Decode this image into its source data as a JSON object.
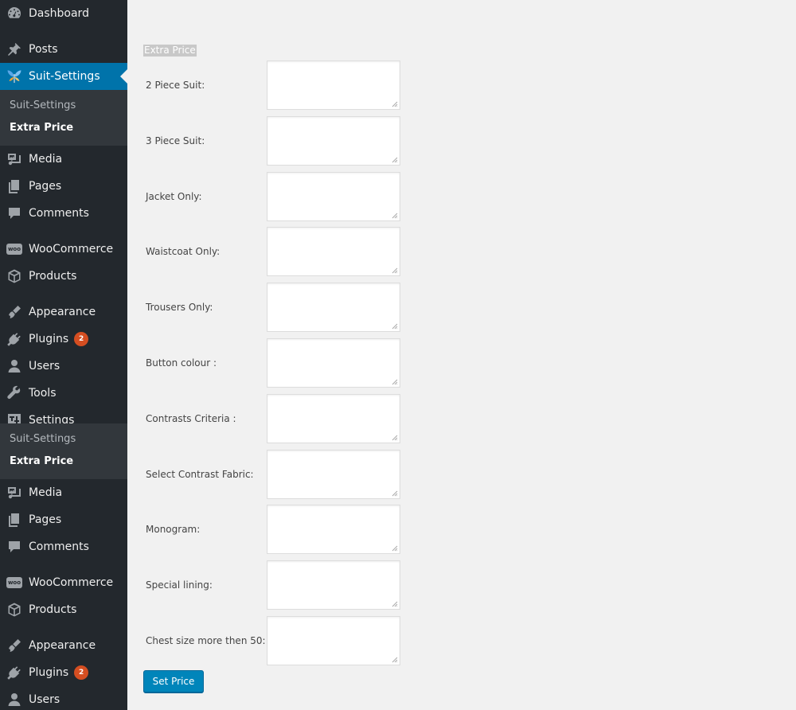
{
  "sidebar": {
    "items": [
      {
        "id": "dashboard",
        "label": "Dashboard",
        "icon": "dashboard-icon"
      },
      {
        "id": "posts",
        "label": "Posts",
        "icon": "pin-icon"
      },
      {
        "id": "suit-settings",
        "label": "Suit-Settings",
        "icon": "butterfly-icon",
        "active": true
      },
      {
        "id": "media",
        "label": "Media",
        "icon": "media-icon"
      },
      {
        "id": "pages",
        "label": "Pages",
        "icon": "pages-icon"
      },
      {
        "id": "comments",
        "label": "Comments",
        "icon": "comment-icon"
      },
      {
        "id": "woocommerce",
        "label": "WooCommerce",
        "icon": "woo-icon",
        "icon_text": "woo"
      },
      {
        "id": "products",
        "label": "Products",
        "icon": "box-icon"
      },
      {
        "id": "appearance",
        "label": "Appearance",
        "icon": "brush-icon"
      },
      {
        "id": "plugins",
        "label": "Plugins",
        "icon": "plug-icon",
        "badge": "2"
      },
      {
        "id": "users",
        "label": "Users",
        "icon": "user-icon"
      },
      {
        "id": "tools",
        "label": "Tools",
        "icon": "wrench-icon"
      },
      {
        "id": "settings",
        "label": "Settings",
        "icon": "sliders-icon"
      }
    ],
    "submenu": [
      {
        "label": "Suit-Settings"
      },
      {
        "label": "Extra Price",
        "current": true
      }
    ],
    "repeat": [
      {
        "id": "media",
        "label": "Media",
        "icon": "media-icon"
      },
      {
        "id": "pages",
        "label": "Pages",
        "icon": "pages-icon"
      },
      {
        "id": "comments",
        "label": "Comments",
        "icon": "comment-icon"
      },
      {
        "id": "woocommerce",
        "label": "WooCommerce",
        "icon": "woo-icon",
        "icon_text": "woo"
      },
      {
        "id": "products",
        "label": "Products",
        "icon": "box-icon"
      },
      {
        "id": "appearance",
        "label": "Appearance",
        "icon": "brush-icon"
      },
      {
        "id": "plugins",
        "label": "Plugins",
        "icon": "plug-icon",
        "badge": "2"
      },
      {
        "id": "users",
        "label": "Users",
        "icon": "user-icon"
      }
    ]
  },
  "form": {
    "title": "Extra Price",
    "fields": [
      {
        "label": "2 Piece Suit:",
        "value": ""
      },
      {
        "label": "3 Piece Suit:",
        "value": ""
      },
      {
        "label": "Jacket Only:",
        "value": ""
      },
      {
        "label": "Waistcoat Only:",
        "value": ""
      },
      {
        "label": "Trousers Only:",
        "value": ""
      },
      {
        "label": "Button colour :",
        "value": ""
      },
      {
        "label": "Contrasts Criteria :",
        "value": ""
      },
      {
        "label": "Select Contrast Fabric:",
        "value": ""
      },
      {
        "label": "Monogram:",
        "value": ""
      },
      {
        "label": "Special lining:",
        "value": ""
      },
      {
        "label": "Chest size more then 50:",
        "value": ""
      }
    ],
    "submit_label": "Set Price"
  },
  "colors": {
    "sidebar_bg": "#23282d",
    "submenu_bg": "#32373c",
    "active_bg": "#0073aa",
    "badge_bg": "#d54e21",
    "button_bg": "#0085ba",
    "page_bg": "#f1f1f1"
  }
}
